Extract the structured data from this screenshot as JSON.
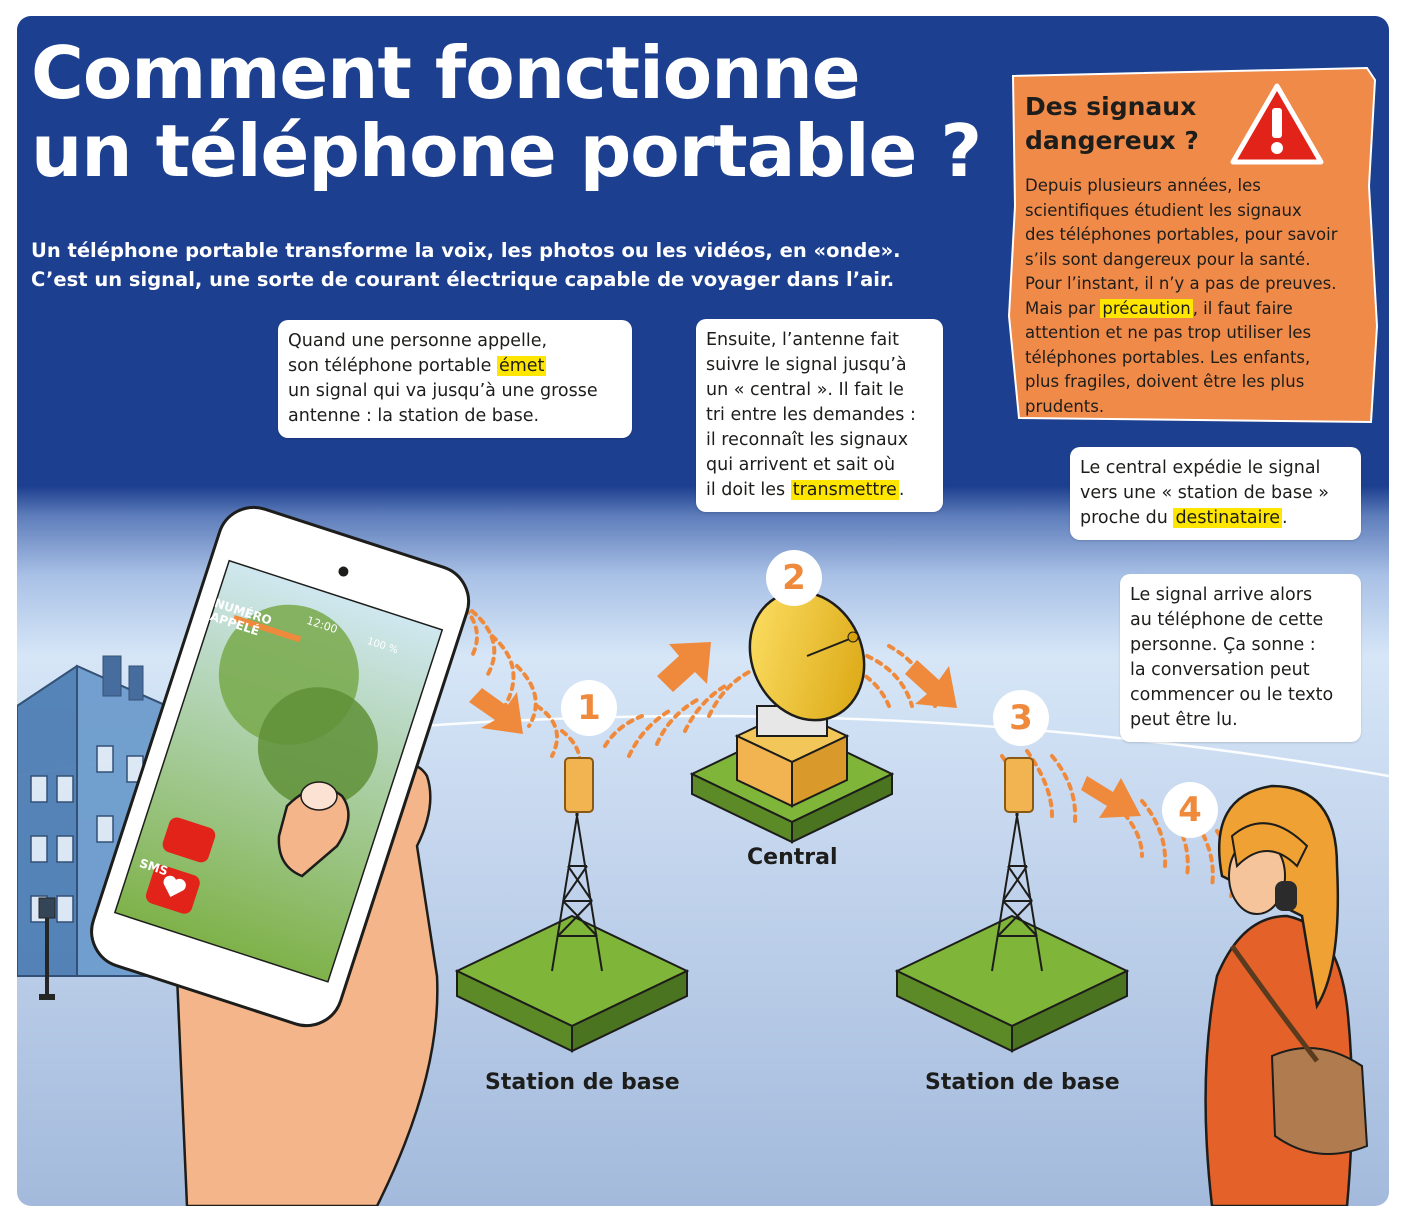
{
  "title": {
    "line1": "Comment fonctionne",
    "line2": "un téléphone portable ?"
  },
  "intro": {
    "line1": "Un téléphone portable transforme la voix, les photos ou les vidéos, en «onde».",
    "line2": "C’est un signal, une sorte de courant électrique capable de voyager dans l’air."
  },
  "warning": {
    "title_line1": "Des signaux",
    "title_line2": "dangereux ?",
    "lines": [
      "Depuis plusieurs années, les",
      "scientifiques étudient les signaux",
      "des téléphones portables, pour savoir",
      "s’ils sont dangereux pour la santé.",
      "Pour l’instant, il n’y a pas de preuves."
    ],
    "line6_before": "Mais par ",
    "line6_highlight": "précaution",
    "line6_after": ", il faut faire",
    "lines_end": [
      "attention et ne pas trop utiliser les",
      "téléphones portables. Les enfants,",
      "plus fragiles, doivent être les plus",
      "prudents."
    ],
    "triangle_color": "#e2231a",
    "panel_color": "#ef8a49"
  },
  "bubble1": {
    "line1": "Quand une personne appelle,",
    "line2_before": "son téléphone portable ",
    "line2_highlight": "émet",
    "line3": "un signal qui va jusqu’à une grosse",
    "line4": "antenne : la station de base."
  },
  "bubble2": {
    "lines": [
      "Ensuite, l’antenne fait",
      "suivre le signal jusqu’à",
      "un « central ». Il fait le",
      "tri entre les demandes :",
      "il reconnaît les signaux",
      "qui arrivent et sait où"
    ],
    "line7_before": "il doit les ",
    "line7_highlight": "transmettre",
    "line7_after": "."
  },
  "bubble3": {
    "line1": "Le central expédie le signal",
    "line2": "vers une « station de base »",
    "line3_before": "proche du ",
    "line3_highlight": "destinataire",
    "line3_after": "."
  },
  "bubble4": {
    "lines": [
      "Le signal arrive alors",
      "au téléphone de cette",
      "personne. Ça sonne :",
      "la conversation peut",
      "commencer ou le texto",
      "peut être lu."
    ]
  },
  "steps": [
    "1",
    "2",
    "3",
    "4"
  ],
  "labels": {
    "station_left": "Station de base",
    "central": "Central",
    "station_right": "Station de base"
  },
  "phone_screen": {
    "caller_line1": "NUMÉRO",
    "caller_line2": "APPELÉ",
    "time": "12:00",
    "battery": "100 %",
    "sms_label": "SMS"
  },
  "colors": {
    "sky_blue": "#1d3f8f",
    "highlight": "#ffe600",
    "signal_orange": "#ef8a3c",
    "ground_green": "#7fb539"
  }
}
